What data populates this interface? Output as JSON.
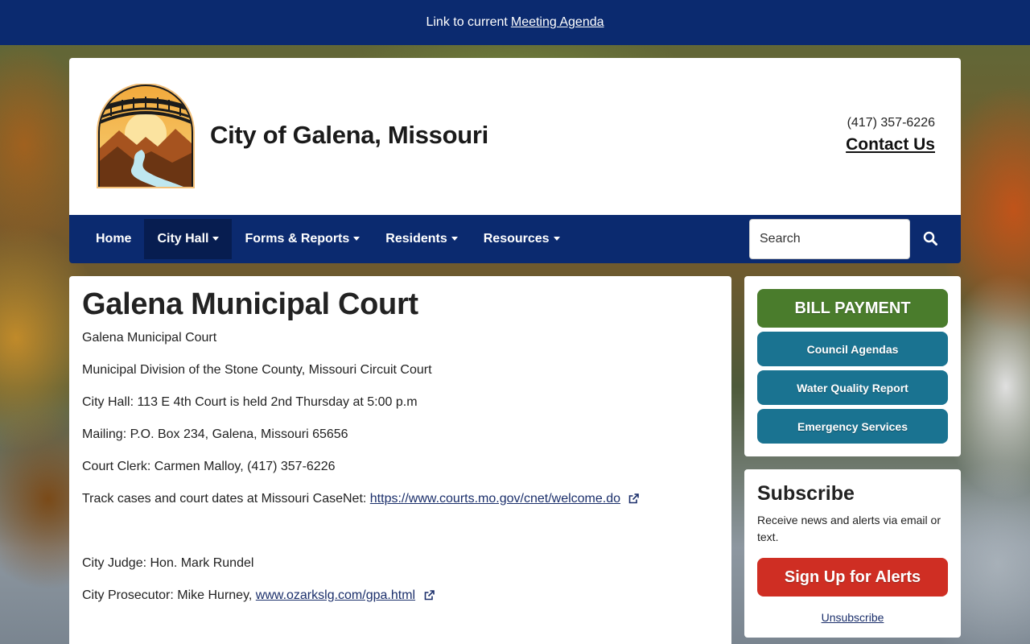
{
  "banner": {
    "prefix": "Link to current",
    "link_label": "Meeting Agenda"
  },
  "header": {
    "title": "City of Galena, Missouri",
    "phone": "(417) 357-6226",
    "contact_label": "Contact Us"
  },
  "nav": {
    "items": [
      {
        "label": "Home",
        "dropdown": false
      },
      {
        "label": "City Hall",
        "dropdown": true,
        "active": true
      },
      {
        "label": "Forms & Reports",
        "dropdown": true
      },
      {
        "label": "Residents",
        "dropdown": true
      },
      {
        "label": "Resources",
        "dropdown": true
      }
    ],
    "search_placeholder": "Search"
  },
  "main": {
    "title": "Galena Municipal Court",
    "p1": "Galena Municipal Court",
    "p2": "Municipal Division of the Stone County, Missouri Circuit Court",
    "p3": "City Hall: 113 E 4th Court is held 2nd Thursday at 5:00 p.m",
    "p4": "Mailing: P.O. Box 234, Galena, Missouri 65656",
    "p5": "Court Clerk: Carmen Malloy, (417) 357-6226",
    "p6_prefix": "Track cases and court dates at Missouri CaseNet:",
    "p6_link": "https://www.courts.mo.gov/cnet/welcome.do",
    "p7": "City Judge: Hon. Mark Rundel",
    "p8_prefix": "City Prosecutor: Mike Hurney,",
    "p8_link": "www.ozarkslg.com/gpa.html"
  },
  "sidebar": {
    "bill_payment": "BILL PAYMENT",
    "council_agendas": "Council Agendas",
    "water_quality": "Water Quality Report",
    "emergency": "Emergency Services",
    "subscribe_title": "Subscribe",
    "subscribe_text": "Receive news and alerts via email or text.",
    "signup": "Sign Up for Alerts",
    "unsubscribe": "Unsubscribe"
  },
  "colors": {
    "navy": "#0b2a6f",
    "bill_green": "#4a7c2c",
    "teal": "#1a7391",
    "alert_red": "#cf2e23"
  }
}
